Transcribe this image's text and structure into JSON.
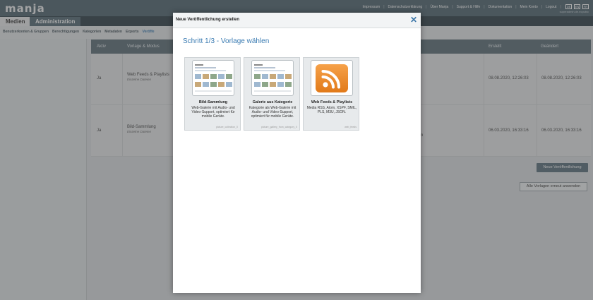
{
  "app": {
    "logo": "manja",
    "topnav": [
      "Impressum",
      "Datenschutzerklärung",
      "Über Manja",
      "Support & Hilfe",
      "Dokumentation",
      "Mein Konto",
      "Logout"
    ],
    "lang": [
      "DE",
      "EN",
      "FR"
    ],
    "user_sub": "superadmin.de.ecpubic"
  },
  "tabs": {
    "medien": "Medien",
    "administration": "Administration"
  },
  "subnav": [
    "Benutzerkonten & Gruppen",
    "Berechtigungen",
    "Kategorien",
    "Metadaten",
    "Exports",
    "Veröffe"
  ],
  "table": {
    "headers": {
      "aktiv": "Aktiv",
      "vorlage": "Vorlage & Modus",
      "erstellt": "Erstellt",
      "geaendert": "Geändert"
    },
    "rows": [
      {
        "aktiv": "Ja",
        "vorlage": "Web Feeds & Playlists",
        "modus": "Einzelne Dateien",
        "erstellt": "08.08.2020, 12:26:03",
        "geaendert": "08.08.2020, 12:26:03",
        "extra": ""
      },
      {
        "aktiv": "Ja",
        "vorlage": "Bild-Sammlung",
        "modus": "Einzelne Dateien",
        "erstellt": "06.03.2020, 16:33:16",
        "geaendert": "06.03.2020, 16:33:16",
        "extra": "n"
      }
    ]
  },
  "buttons": {
    "new_publication": "Neue Veröffentlichung",
    "reapply": "Alle Vorlagen erneut anwenden"
  },
  "modal": {
    "title": "Neue Veröffentlichung erstellen",
    "step": "Schritt 1/3 - Vorlage wählen",
    "cards": [
      {
        "title": "Bild-Sammlung",
        "desc": "Web-Galerie mit Audio- und Video-Support, optimiert für mobile Geräte.",
        "id": "picture_collection_0"
      },
      {
        "title": "Galerie aus Kategorie",
        "desc": "Kategorie als Web-Galerie mit Audio- und Video-Support, optimiert für mobile Geräte.",
        "id": "picture_gallery_from_category_0"
      },
      {
        "title": "Web Feeds & Playlists",
        "desc": "Media RSS, Atom, XSPF, SMIL, PLS, M3U, JSON.",
        "id": "web_feeds"
      }
    ]
  },
  "colors": {
    "accent": "#3a7bb2",
    "topbar": "#4f6470",
    "rss": "#e17a19"
  }
}
